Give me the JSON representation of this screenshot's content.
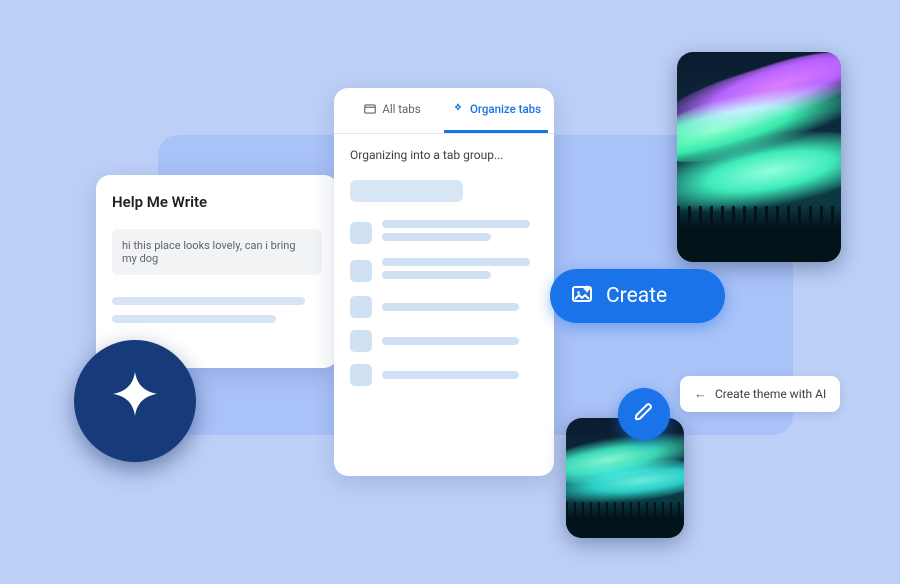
{
  "help_me_write": {
    "title": "Help Me Write",
    "prompt_text": "hi this place looks lovely, can i bring my dog"
  },
  "organize": {
    "tab_all_label": "All tabs",
    "tab_organize_label": "Organize tabs",
    "status": "Organizing into a tab group..."
  },
  "create_button": {
    "label": "Create"
  },
  "theme_chip": {
    "label": "Create theme with AI"
  },
  "colors": {
    "accent": "#1a73e8"
  }
}
